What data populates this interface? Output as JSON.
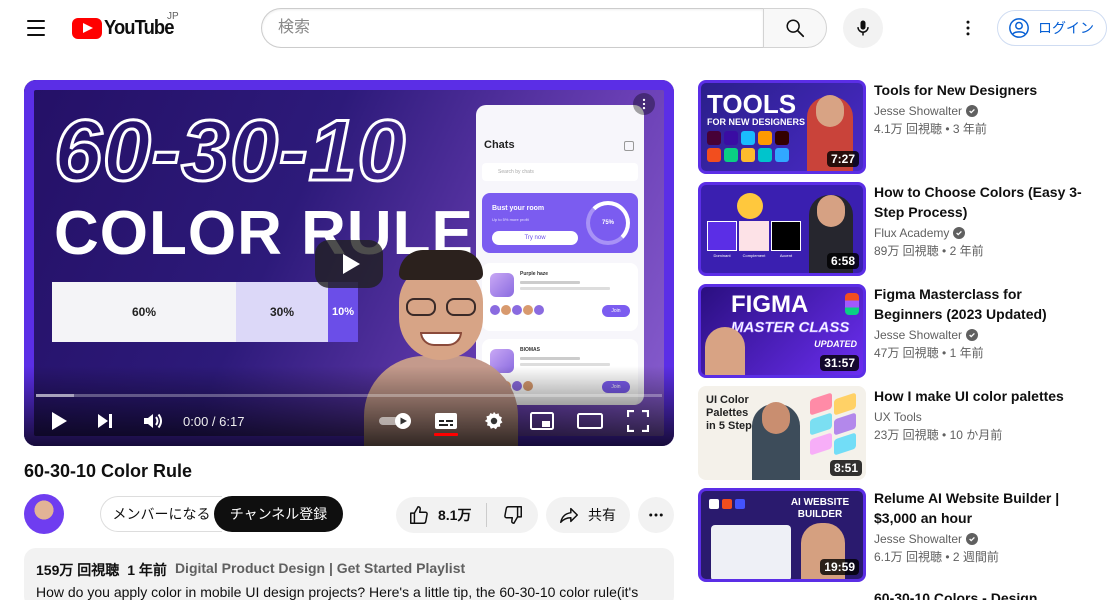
{
  "masthead": {
    "logo_text": "YouTube",
    "country": "JP",
    "search_placeholder": "検索",
    "signin_label": "ログイン"
  },
  "player": {
    "thumb_text_top": "60-30-10",
    "thumb_text_bottom": "COLOR RULE",
    "bar_labels": [
      "60%",
      "30%",
      "10%"
    ],
    "phone": {
      "title": "Chats",
      "search": "Search by chats",
      "card_title": "Bust your room",
      "card_sub": "Up to 5% more profit",
      "card_button": "Try now",
      "card_percent": "75%",
      "row1_name": "Purple haze",
      "row2_name": "BIOMAS",
      "join": "Join"
    },
    "time": "0:00 / 6:17",
    "progress_loaded": 0.06,
    "captions_on": true
  },
  "video": {
    "title": "60-30-10 Color Rule",
    "member_label": "メンバーになる",
    "subscribe_label": "チャンネル登録",
    "likes": "8.1万",
    "share_label": "共有",
    "views": "159万 回視聴",
    "age": "1 年前",
    "tags": "Digital Product Design | Get Started Playlist",
    "description": "How do you apply color in mobile UI design projects? Here's a little tip, the 60-30-10 color rule(it's"
  },
  "recommendations": [
    {
      "title": "Tools for New Designers",
      "channel": "Jesse Showalter",
      "verified": true,
      "views": "4.1万 回視聴",
      "age": "3 年前",
      "duration": "7:27",
      "thumb_title": "TOOLS",
      "thumb_sub": "FOR NEW DESIGNERS"
    },
    {
      "title": "How to Choose Colors (Easy 3-Step Process)",
      "channel": "Flux Academy",
      "verified": true,
      "views": "89万 回視聴",
      "age": "2 年前",
      "duration": "6:58",
      "thumb_labels": [
        "Dominant",
        "Complement",
        "Accent"
      ]
    },
    {
      "title": "Figma Masterclass for Beginners (2023 Updated)",
      "channel": "Jesse Showalter",
      "verified": true,
      "views": "47万 回視聴",
      "age": "1 年前",
      "duration": "31:57",
      "thumb_title": "FIGMA",
      "thumb_sub": "MASTER CLASS",
      "thumb_sub2": "UPDATED"
    },
    {
      "title": "How I make UI color palettes",
      "channel": "UX Tools",
      "verified": false,
      "views": "23万 回視聴",
      "age": "10 か月前",
      "duration": "8:51",
      "thumb_title": "UI Color Palettes in 5 Steps"
    },
    {
      "title": "Relume AI Website Builder | $3,000 an hour",
      "channel": "Jesse Showalter",
      "verified": true,
      "views": "6.1万 回視聴",
      "age": "2 週間前",
      "duration": "19:59",
      "thumb_title": "AI WEBSITE BUILDER"
    },
    {
      "title": "60-30-10 Colors - Design"
    }
  ],
  "colors": {
    "brand_red": "#ff0000",
    "accent_blue": "#065fd4",
    "thumb_purple": "#5b2ee6"
  },
  "icons": {
    "menu": "menu-icon",
    "search": "search-icon",
    "mic": "mic-icon",
    "more": "more-vert-icon",
    "account": "account-icon",
    "play": "play-icon",
    "next": "next-icon",
    "volume": "volume-icon",
    "autoplay": "autoplay-toggle-icon",
    "captions": "captions-icon",
    "settings": "gear-icon",
    "miniplayer": "miniplayer-icon",
    "theater": "theater-icon",
    "fullscreen": "fullscreen-icon",
    "like": "thumbs-up-icon",
    "dislike": "thumbs-down-icon",
    "share": "share-icon",
    "verified": "verified-check-icon"
  }
}
